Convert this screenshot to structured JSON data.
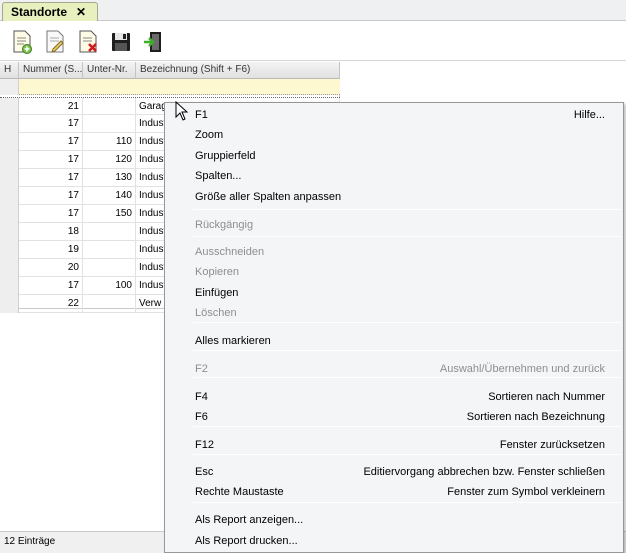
{
  "tab": {
    "title": "Standorte",
    "close": "✕"
  },
  "toolbar": {
    "buttons": [
      {
        "icon": "new-document-icon"
      },
      {
        "icon": "edit-document-icon"
      },
      {
        "icon": "delete-document-icon"
      },
      {
        "icon": "save-icon"
      },
      {
        "icon": "exit-icon"
      }
    ]
  },
  "grid": {
    "headers": [
      "H",
      "Nummer (S...",
      "Unter-Nr.",
      "Bezeichnung (Shift + F6)"
    ],
    "rows": [
      {
        "nummer": "21",
        "unter": "",
        "bez": "Garage"
      },
      {
        "nummer": "17",
        "unter": "",
        "bez": "Indust"
      },
      {
        "nummer": "17",
        "unter": "110",
        "bez": "Indust"
      },
      {
        "nummer": "17",
        "unter": "120",
        "bez": "Indust"
      },
      {
        "nummer": "17",
        "unter": "130",
        "bez": "Indust"
      },
      {
        "nummer": "17",
        "unter": "140",
        "bez": "Indust"
      },
      {
        "nummer": "17",
        "unter": "150",
        "bez": "Indust"
      },
      {
        "nummer": "18",
        "unter": "",
        "bez": "Indust"
      },
      {
        "nummer": "19",
        "unter": "",
        "bez": "Indust"
      },
      {
        "nummer": "20",
        "unter": "",
        "bez": "Indust"
      },
      {
        "nummer": "17",
        "unter": "100",
        "bez": "Indust"
      },
      {
        "nummer": "22",
        "unter": "",
        "bez": "Verw"
      }
    ]
  },
  "status": {
    "count": "12 Einträge"
  },
  "menu": {
    "items": [
      {
        "label": "F1",
        "right": "Hilfe...",
        "disabled": false
      },
      {
        "label": "Zoom",
        "right": "",
        "disabled": false
      },
      {
        "label": "Gruppierfeld",
        "right": "",
        "disabled": false
      },
      {
        "label": "Spalten...",
        "right": "",
        "disabled": false
      },
      {
        "label": "Größe aller Spalten anpassen",
        "right": "",
        "disabled": false
      },
      {
        "label": "Rückgängig",
        "right": "",
        "disabled": true
      },
      {
        "label": "Ausschneiden",
        "right": "",
        "disabled": true
      },
      {
        "label": "Kopieren",
        "right": "",
        "disabled": true
      },
      {
        "label": "Einfügen",
        "right": "",
        "disabled": false
      },
      {
        "label": "Löschen",
        "right": "",
        "disabled": true
      },
      {
        "label": "Alles markieren",
        "right": "",
        "disabled": false
      },
      {
        "label": "F2",
        "right": "Auswahl/Übernehmen und zurück",
        "disabled": true
      },
      {
        "label": "F4",
        "right": "Sortieren nach Nummer",
        "disabled": false
      },
      {
        "label": "F6",
        "right": "Sortieren nach Bezeichnung",
        "disabled": false
      },
      {
        "label": "F12",
        "right": "Fenster zurücksetzen",
        "disabled": false
      },
      {
        "label": "Esc",
        "right": "Editiervorgang abbrechen bzw. Fenster schließen",
        "disabled": false
      },
      {
        "label": "Rechte Maustaste",
        "right": "Fenster zum Symbol verkleinern",
        "disabled": false
      },
      {
        "label": "Als Report anzeigen...",
        "right": "",
        "disabled": false
      },
      {
        "label": "Als Report drucken...",
        "right": "",
        "disabled": false
      }
    ]
  }
}
